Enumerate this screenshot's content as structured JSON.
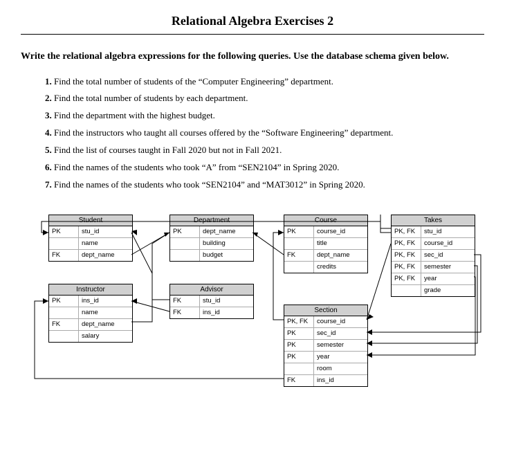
{
  "title": "Relational Algebra Exercises 2",
  "prompt": "Write the relational algebra expressions for the following queries. Use the database schema given below.",
  "questions": [
    "Find the total number of students of the “Computer Engineering” department.",
    "Find the total number of students by each department.",
    "Find the department with the highest budget.",
    "Find the instructors who taught all courses offered by the “Software Engineering” department.",
    "Find the list of courses taught in Fall 2020 but not in Fall 2021.",
    "Find the names of the students who took “A” from “SEN2104” in Spring 2020.",
    "Find the names of the students who took “SEN2104” and “MAT3012” in Spring 2020."
  ],
  "schema": {
    "student": {
      "name": "Student",
      "cols": [
        [
          "PK",
          "stu_id"
        ],
        [
          "",
          "name"
        ],
        [
          "FK",
          "dept_name"
        ]
      ]
    },
    "department": {
      "name": "Department",
      "cols": [
        [
          "PK",
          "dept_name"
        ],
        [
          "",
          "building"
        ],
        [
          "",
          "budget"
        ]
      ]
    },
    "course": {
      "name": "Course",
      "cols": [
        [
          "PK",
          "course_id"
        ],
        [
          "",
          "title"
        ],
        [
          "FK",
          "dept_name"
        ],
        [
          "",
          "credits"
        ]
      ]
    },
    "takes": {
      "name": "Takes",
      "cols": [
        [
          "PK, FK",
          "stu_id"
        ],
        [
          "PK, FK",
          "course_id"
        ],
        [
          "PK, FK",
          "sec_id"
        ],
        [
          "PK, FK",
          "semester"
        ],
        [
          "PK, FK",
          "year"
        ],
        [
          "",
          "grade"
        ]
      ]
    },
    "instructor": {
      "name": "Instructor",
      "cols": [
        [
          "PK",
          "ins_id"
        ],
        [
          "",
          "name"
        ],
        [
          "FK",
          "dept_name"
        ],
        [
          "",
          "salary"
        ]
      ]
    },
    "advisor": {
      "name": "Advisor",
      "cols": [
        [
          "FK",
          "stu_id"
        ],
        [
          "FK",
          "ins_id"
        ]
      ]
    },
    "section": {
      "name": "Section",
      "cols": [
        [
          "PK, FK",
          "course_id"
        ],
        [
          "PK",
          "sec_id"
        ],
        [
          "PK",
          "semester"
        ],
        [
          "PK",
          "year"
        ],
        [
          "",
          "room"
        ],
        [
          "FK",
          "ins_id"
        ]
      ]
    }
  }
}
